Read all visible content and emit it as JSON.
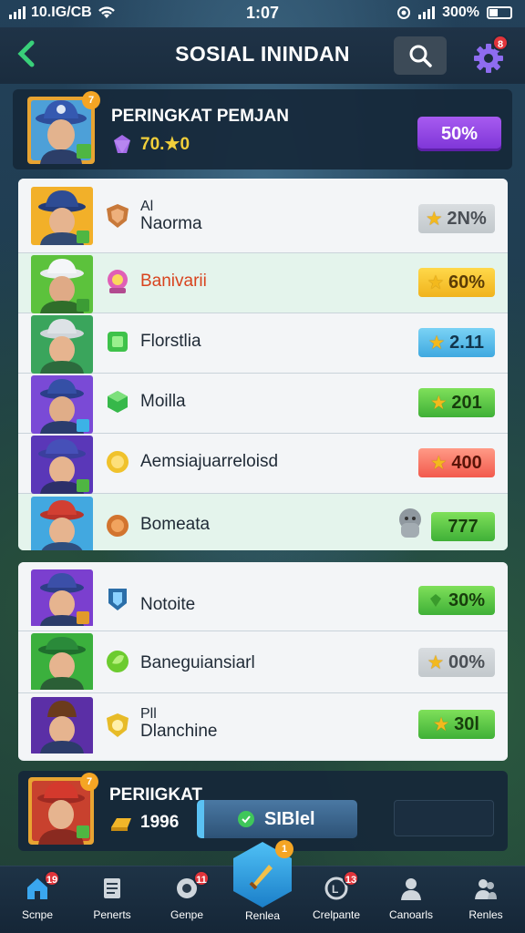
{
  "status_bar": {
    "carrier": "10.IG/CB",
    "time": "1:07",
    "battery": "300%"
  },
  "header": {
    "title": "SOSIAL ININDAN"
  },
  "profile": {
    "badge": "7",
    "title": "PERINGKAT PEMJAN",
    "stat": "70.★0",
    "button": "50%"
  },
  "ranking": [
    {
      "title": "Al",
      "name": "Naorma",
      "value": "2N%",
      "pill_color": "gray"
    },
    {
      "title": "",
      "name": "Banivarii",
      "value": "60%",
      "pill_color": "yellow",
      "name_color": "#d8431e"
    },
    {
      "title": "",
      "name": "Florstlia",
      "value": "2.11",
      "pill_color": "blue"
    },
    {
      "title": "",
      "name": "Moilla",
      "value": "201",
      "pill_color": "green"
    },
    {
      "title": "",
      "name": "Aemsiajuarreloisd",
      "value": "400",
      "pill_color": "red"
    },
    {
      "title": "",
      "name": "Bomeata",
      "value": "777",
      "pill_color": "green"
    }
  ],
  "ranking2": [
    {
      "title": "",
      "name": "Notoite",
      "value": "30%",
      "pill_color": "green"
    },
    {
      "title": "",
      "name": "Baneguiansiarl",
      "value": "00%",
      "pill_color": "gray"
    },
    {
      "title": "Pll",
      "name": "Dlanchine",
      "value": "30l",
      "pill_color": "green"
    }
  ],
  "me": {
    "badge": "7",
    "title": "PERIIGKAT",
    "stat": "1996",
    "button": "SIBlel"
  },
  "nav": [
    {
      "label": "Scnpe",
      "badge": "19",
      "icon": "home-icon"
    },
    {
      "label": "Penerts",
      "badge": "",
      "icon": "document-icon"
    },
    {
      "label": "Genpe",
      "badge": "11",
      "icon": "gamepad-icon"
    },
    {
      "label": "Renlea",
      "badge": "1",
      "icon": "sword-icon"
    },
    {
      "label": "Crelpante",
      "badge": "13",
      "icon": "trophy-icon"
    },
    {
      "label": "Canoarls",
      "badge": "",
      "icon": "person-icon"
    },
    {
      "label": "Renles",
      "badge": "",
      "icon": "people-icon"
    }
  ],
  "colors": {
    "accent_green": "#39d07a",
    "purple": "#8c3fe0",
    "header_bg": "#1f3347",
    "badge_red": "#e2343a"
  }
}
